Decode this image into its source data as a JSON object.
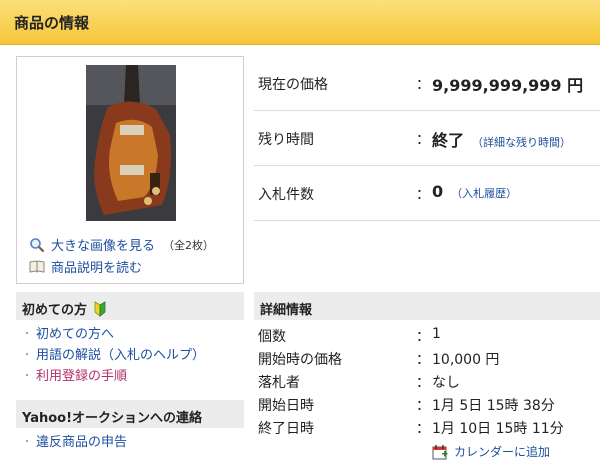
{
  "header": {
    "title": "商品の情報"
  },
  "image_panel": {
    "large_image_link": "大きな画像を見る",
    "image_count": "（全2枚）",
    "description_link": "商品説明を読む"
  },
  "price": {
    "current_label": "現在の価格",
    "current_sep": "：",
    "current_value": "9,999,999,999 円",
    "remaining_label": "残り時間",
    "remaining_sep": "：",
    "remaining_value": "終了",
    "remaining_detail_link": "（詳細な残り時間）",
    "bids_label": "入札件数",
    "bids_sep": "：",
    "bids_value": "0",
    "bids_history_link": "（入札履歴）"
  },
  "beginners": {
    "title": "初めての方",
    "items": [
      "初めての方へ",
      "用語の解説（入札のヘルプ）",
      "利用登録の手順"
    ]
  },
  "contact": {
    "title": "Yahoo!オークションへの連絡",
    "items": [
      "違反商品の申告"
    ]
  },
  "details": {
    "title": "詳細情報",
    "rows": [
      {
        "label": "個数",
        "sep": "：",
        "value": "1"
      },
      {
        "label": "開始時の価格",
        "sep": "：",
        "value": "10,000 円"
      },
      {
        "label": "落札者",
        "sep": "：",
        "value": "なし"
      },
      {
        "label": "開始日時",
        "sep": "：",
        "value": "1月 5日 15時 38分"
      },
      {
        "label": "終了日時",
        "sep": "：",
        "value": "1月 10日 15時 11分"
      }
    ],
    "calendar_link": "カレンダーに追加"
  },
  "colors": {
    "header_yellow": "#f5c638",
    "link_blue": "#1d4fa0",
    "link_pink": "#b0306a",
    "section_gray": "#ececec"
  },
  "icons": [
    "magnifier-icon",
    "book-icon",
    "beginner-mark-icon",
    "calendar-icon"
  ]
}
